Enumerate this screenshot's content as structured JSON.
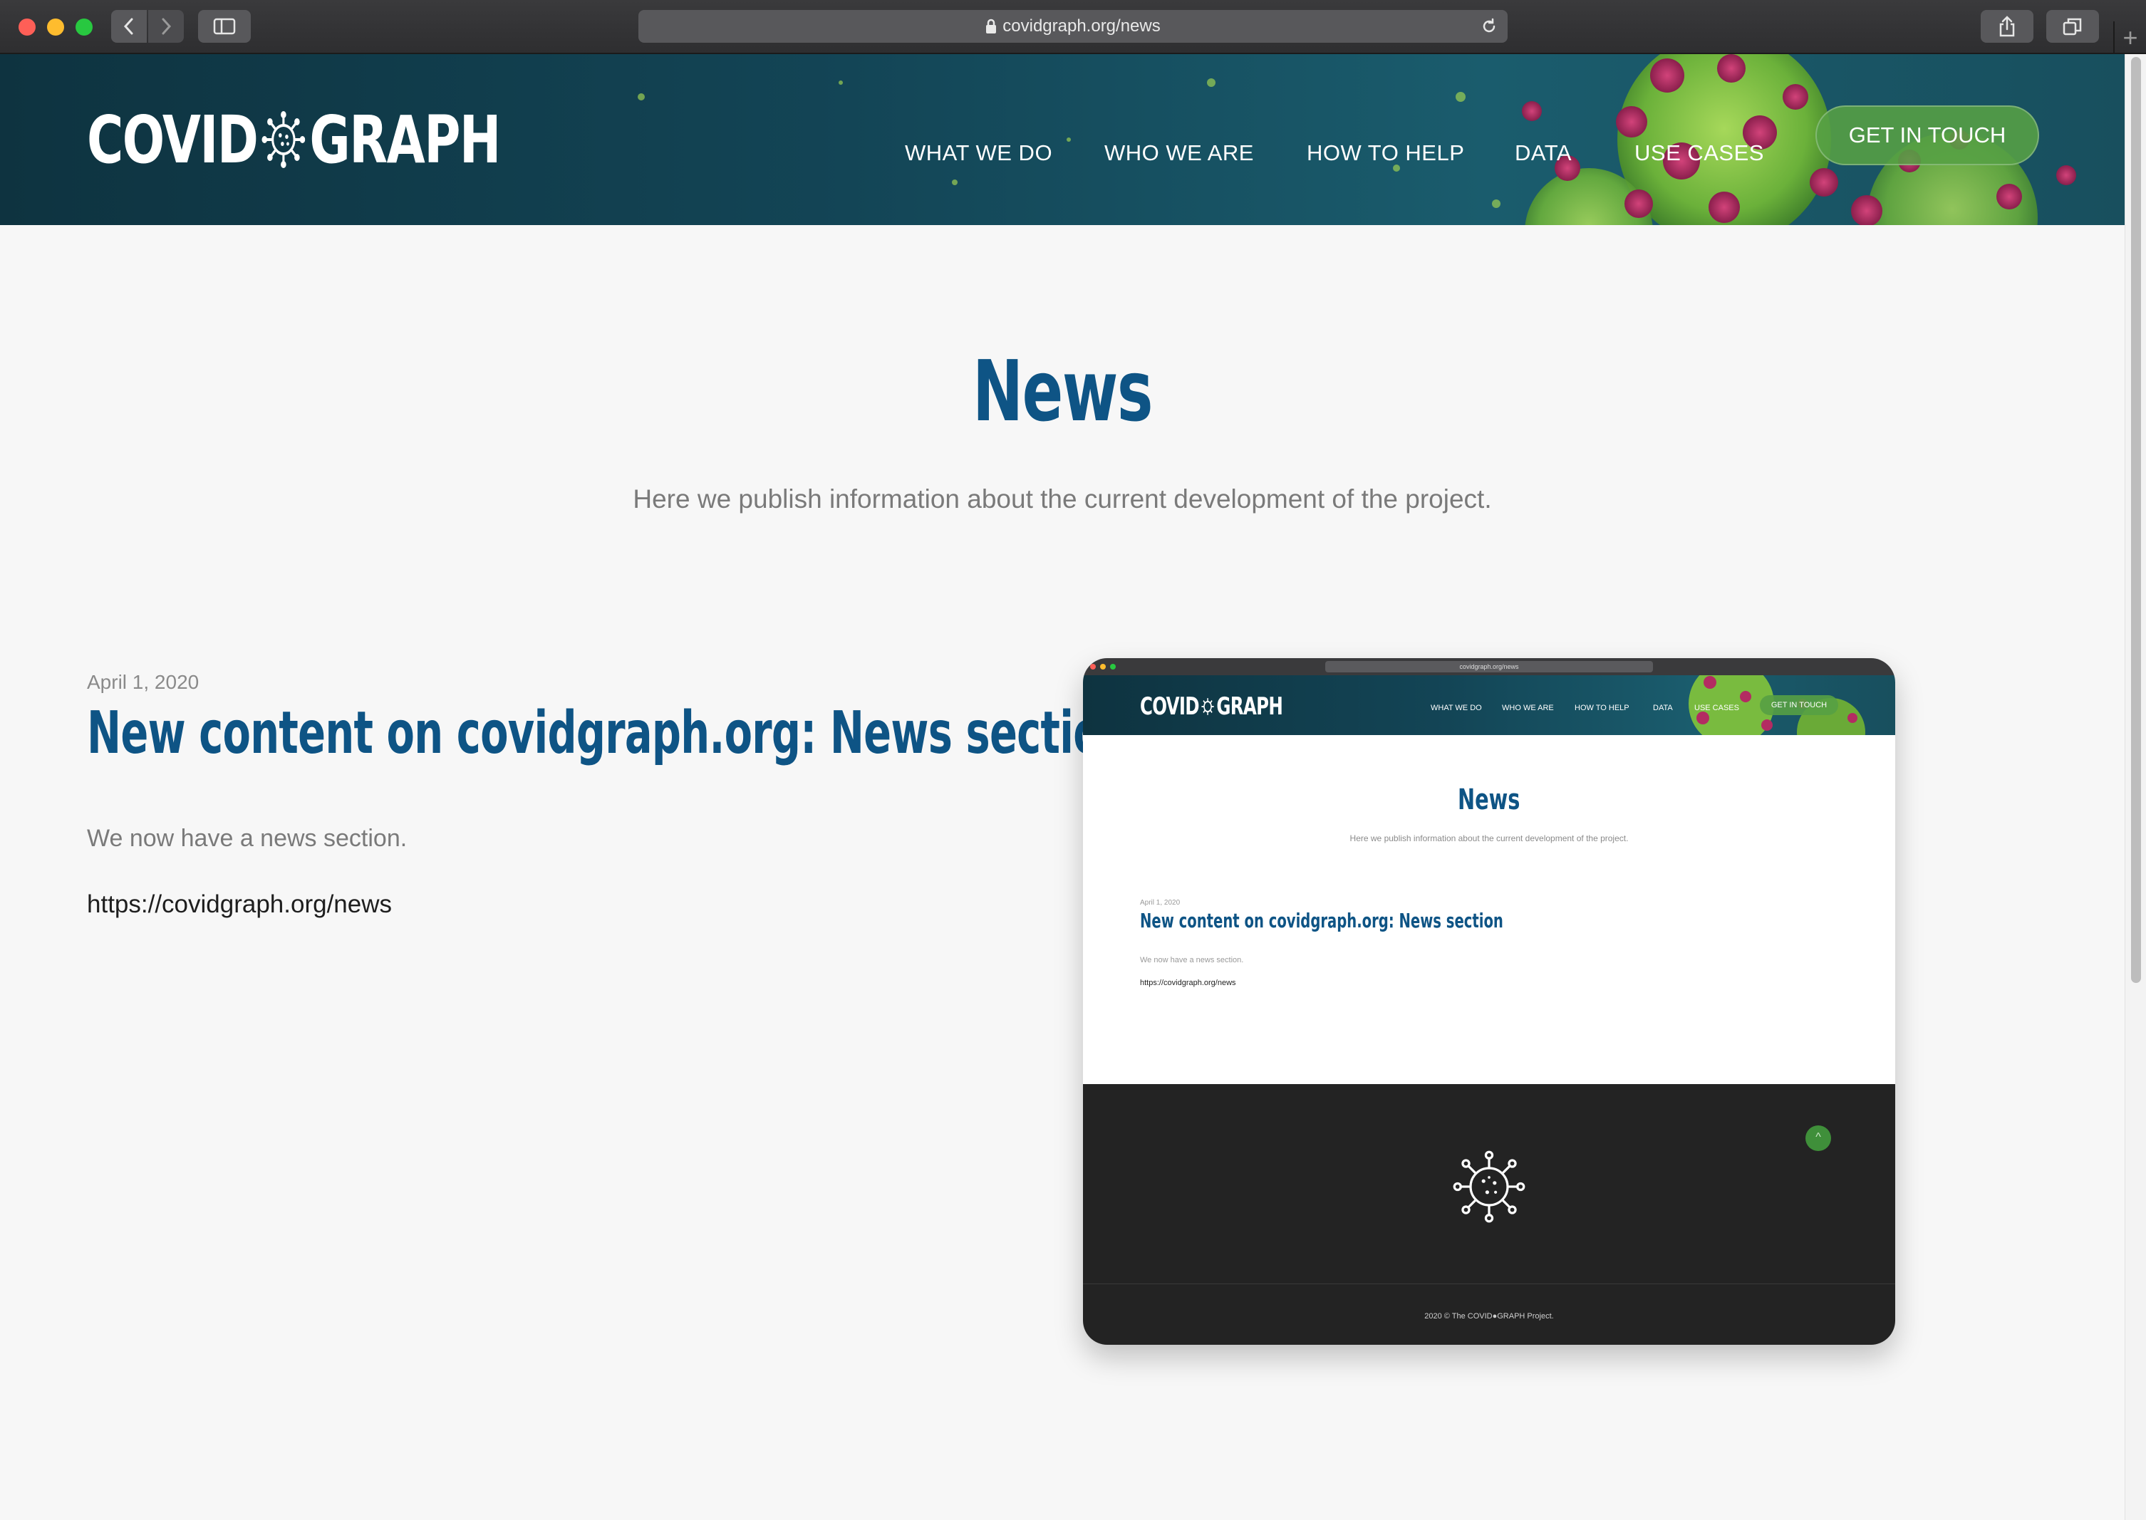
{
  "browser": {
    "url": "covidgraph.org/news",
    "icons": [
      "back-icon",
      "forward-icon",
      "sidebar-icon",
      "lock-icon",
      "reload-icon",
      "share-icon",
      "tabs-icon",
      "new-tab-icon"
    ]
  },
  "header": {
    "logo_left": "COVID",
    "logo_right": "GRAPH",
    "nav": [
      {
        "label": "WHAT WE DO"
      },
      {
        "label": "WHO WE ARE"
      },
      {
        "label": "HOW TO HELP"
      },
      {
        "label": "DATA"
      },
      {
        "label": "USE CASES"
      }
    ],
    "cta_label": "GET IN TOUCH"
  },
  "page": {
    "title": "News",
    "intro": "Here we publish information about the current development of the project."
  },
  "posts": [
    {
      "date": "April 1, 2020",
      "title": "New content on covidgraph.org: News section",
      "summary": "We now have a news section.",
      "link": "https://covidgraph.org/news",
      "thumbnail": {
        "url": "covidgraph.org/news",
        "logo_left": "COVID",
        "logo_right": "GRAPH",
        "nav": [
          "WHAT WE DO",
          "WHO WE ARE",
          "HOW TO HELP",
          "DATA",
          "USE CASES"
        ],
        "cta_label": "GET IN TOUCH",
        "title": "News",
        "intro": "Here we publish information about the current development of the project.",
        "post_date": "April 1, 2020",
        "post_title": "New content on covidgraph.org: News section",
        "post_summary": "We now have a news section.",
        "post_link": "https://covidgraph.org/news",
        "copyright": "2020 © The COVID●GRAPH Project."
      }
    }
  ],
  "colors": {
    "brand_blue": "#0e5485",
    "cta_green": "#56a044",
    "header_teal": "#134556",
    "footer_dark": "#232323",
    "page_bg": "#f7f7f7"
  }
}
